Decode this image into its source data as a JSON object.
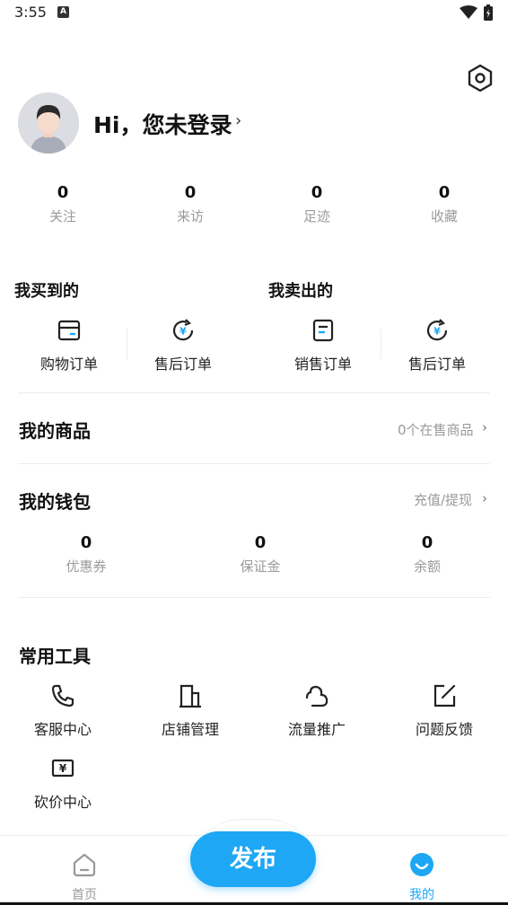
{
  "status_bar": {
    "time": "3:55",
    "notif_glyph": "A"
  },
  "header": {
    "settings_icon": "gear-hexagon-icon",
    "greeting": "Hi，您未登录",
    "chevron": "›"
  },
  "stats": [
    {
      "value": "0",
      "label": "关注"
    },
    {
      "value": "0",
      "label": "来访"
    },
    {
      "value": "0",
      "label": "足迹"
    },
    {
      "value": "0",
      "label": "收藏"
    }
  ],
  "bought": {
    "title": "我买到的",
    "items": [
      {
        "label": "购物订单",
        "icon": "wallet-icon"
      },
      {
        "label": "售后订单",
        "icon": "yen-refund-icon"
      }
    ]
  },
  "sold": {
    "title": "我卖出的",
    "items": [
      {
        "label": "销售订单",
        "icon": "document-icon"
      },
      {
        "label": "售后订单",
        "icon": "yen-refund-icon"
      }
    ]
  },
  "my_goods": {
    "title": "我的商品",
    "right": "0个在售商品",
    "chevron": "›"
  },
  "wallet": {
    "title": "我的钱包",
    "right": "充值/提现",
    "chevron": "›",
    "stats": [
      {
        "value": "0",
        "label": "优惠券"
      },
      {
        "value": "0",
        "label": "保证金"
      },
      {
        "value": "0",
        "label": "余额"
      }
    ]
  },
  "tools": {
    "title": "常用工具",
    "items": [
      {
        "label": "客服中心",
        "icon": "phone-icon"
      },
      {
        "label": "店铺管理",
        "icon": "building-icon"
      },
      {
        "label": "流量推广",
        "icon": "cloud-icon"
      },
      {
        "label": "问题反馈",
        "icon": "edit-icon"
      },
      {
        "label": "砍价中心",
        "icon": "yen-ticket-icon"
      }
    ]
  },
  "bottom_nav": {
    "home_label": "首页",
    "publish_label": "发布",
    "mine_label": "我的",
    "active_color": "#1ea7f4",
    "inactive_color": "#999999"
  },
  "colors": {
    "accent": "#1ea7f4",
    "secondary_text": "#9a9a9a"
  }
}
